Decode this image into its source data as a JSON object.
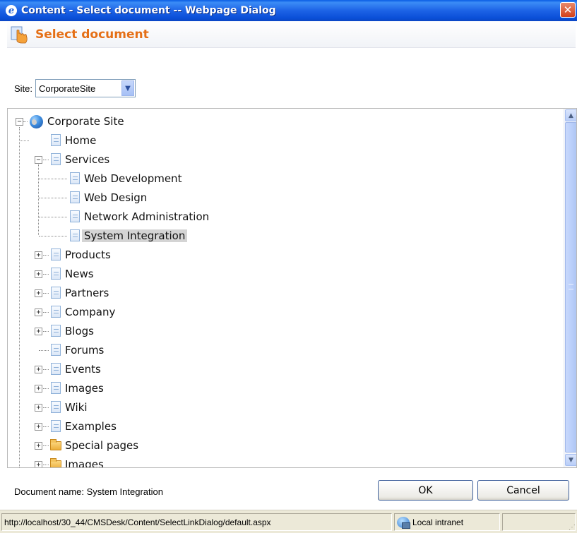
{
  "window": {
    "title": "Content - Select document -- Webpage Dialog",
    "close_glyph": "✕",
    "app_icon": "ie-icon"
  },
  "header": {
    "title": "Select document",
    "icon": "select-document-icon"
  },
  "site": {
    "label": "Site:",
    "selected": "CorporateSite"
  },
  "tree": {
    "root": "Corporate Site",
    "nodes": {
      "home": "Home",
      "services": "Services",
      "web_development": "Web Development",
      "web_design": "Web Design",
      "network_administration": "Network Administration",
      "system_integration": "System Integration",
      "products": "Products",
      "news": "News",
      "partners": "Partners",
      "company": "Company",
      "blogs": "Blogs",
      "forums": "Forums",
      "events": "Events",
      "images": "Images",
      "wiki": "Wiki",
      "examples": "Examples",
      "special_pages": "Special pages",
      "images_folder": "Images"
    },
    "selected": "System Integration",
    "expand_glyph": "+",
    "collapse_glyph": "−"
  },
  "footer": {
    "document_name": "Document name: System Integration",
    "ok_label": "OK",
    "cancel_label": "Cancel"
  },
  "statusbar": {
    "url": "http://localhost/30_44/CMSDesk/Content/SelectLinkDialog/default.aspx",
    "zone": "Local intranet"
  },
  "colors": {
    "title_bar": "#1d63e6",
    "header_title": "#e56f16",
    "selection": "#d4d4d4"
  }
}
